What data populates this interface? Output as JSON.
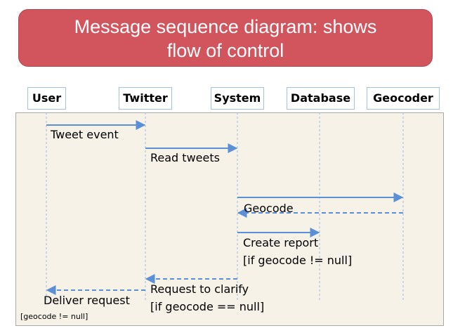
{
  "title": {
    "line1": "Message sequence diagram: shows",
    "line2": "flow of control",
    "fill": "#d2555e"
  },
  "lifelines": [
    {
      "id": "user",
      "label": "User"
    },
    {
      "id": "twitter",
      "label": "Twitter"
    },
    {
      "id": "system",
      "label": "System"
    },
    {
      "id": "database",
      "label": "Database"
    },
    {
      "id": "geocoder",
      "label": "Geocoder"
    }
  ],
  "messages": [
    {
      "from": "user",
      "to": "twitter",
      "style": "solid",
      "label": "Tweet event"
    },
    {
      "from": "twitter",
      "to": "system",
      "style": "solid",
      "label": "Read tweets"
    },
    {
      "from": "system",
      "to": "geocoder",
      "style": "solid",
      "label": ""
    },
    {
      "from": "geocoder",
      "to": "system",
      "style": "dashed",
      "label": "Geocode"
    },
    {
      "from": "system",
      "to": "database",
      "style": "solid",
      "label": "Create report",
      "label2": "[if geocode != null]"
    },
    {
      "from": "system",
      "to": "twitter",
      "style": "dashed",
      "label": ""
    },
    {
      "from": "twitter",
      "to": "user",
      "style": "dashed",
      "label": "Request to clarify",
      "label2": "[if geocode == null]"
    }
  ],
  "notes": {
    "deliver_request": "Deliver request",
    "guard": "[geocode != null]"
  },
  "colors": {
    "arrow": "#5b8fd6",
    "lifeline": "#9dbbe0",
    "frame_bg": "#f6f2e8"
  }
}
